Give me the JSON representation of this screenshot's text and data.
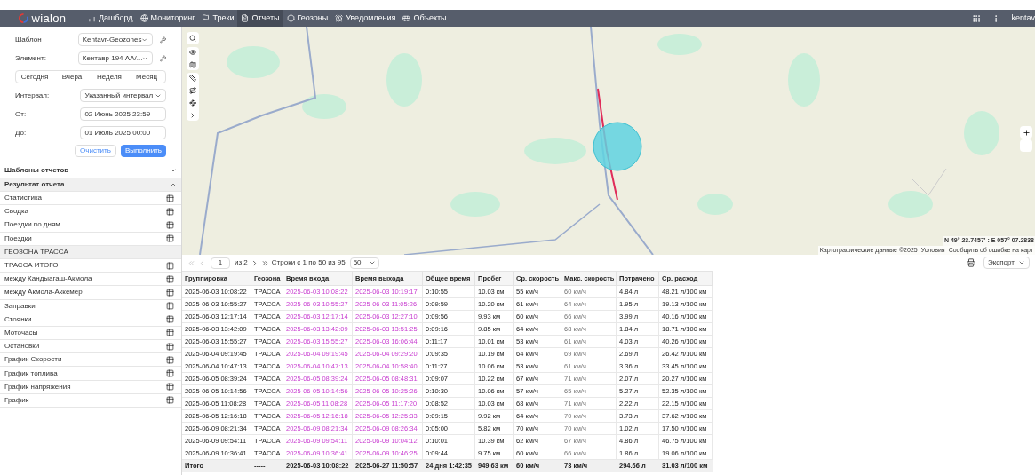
{
  "nav": {
    "logo": "wialon",
    "items": [
      {
        "label": "Дашборд",
        "selected": false
      },
      {
        "label": "Мониторинг",
        "selected": false
      },
      {
        "label": "Треки",
        "selected": false
      },
      {
        "label": "Отчеты",
        "selected": true
      },
      {
        "label": "Геозоны",
        "selected": false
      },
      {
        "label": "Уведомления",
        "selected": false
      },
      {
        "label": "Объекты",
        "selected": false
      }
    ],
    "user": "kentav"
  },
  "form": {
    "template": {
      "label": "Шаблон",
      "value": "Kentavr-Geozones"
    },
    "element": {
      "label": "Элемент:",
      "value": "Кентавр 194 AA/..."
    },
    "periods": [
      {
        "label": "Сегодня",
        "selected": false
      },
      {
        "label": "Вчера",
        "selected": false
      },
      {
        "label": "Неделя",
        "selected": false
      },
      {
        "label": "Месяц",
        "selected": false
      }
    ],
    "interval": {
      "label": "Интервал:",
      "value": "Указанный интервал"
    },
    "from": {
      "label": "От:",
      "value": "02 Июнь 2025 23:59"
    },
    "to": {
      "label": "До:",
      "value": "01 Июль 2025 00:00"
    },
    "buttons": [
      {
        "label": "Очистить",
        "kind": "secondary"
      },
      {
        "label": "Выполнить",
        "kind": "primary"
      }
    ]
  },
  "sections": [
    {
      "title": "Шаблоны отчетов",
      "expanded": false
    },
    {
      "title": "Результат отчета",
      "expanded": true,
      "items": [
        {
          "label": "Статистика",
          "kind": "item"
        },
        {
          "label": "Сводка",
          "kind": "item"
        },
        {
          "label": "Поездки по дням",
          "kind": "item"
        },
        {
          "label": "Поездки",
          "kind": "item"
        },
        {
          "label": "ГЕОЗОНА ТРАССА",
          "kind": "group"
        },
        {
          "label": "ТРАССА ИТОГО",
          "kind": "item"
        },
        {
          "label": "между Кандыагаш-Акмола",
          "kind": "item"
        },
        {
          "label": "между Акмола-Аккемер",
          "kind": "item"
        },
        {
          "label": "Заправки",
          "kind": "item"
        },
        {
          "label": "Стоянки",
          "kind": "item"
        },
        {
          "label": "Моточасы",
          "kind": "item"
        },
        {
          "label": "Остановки",
          "kind": "item"
        },
        {
          "label": "График Скорости",
          "kind": "item"
        },
        {
          "label": "График топлива",
          "kind": "item"
        },
        {
          "label": "График напряжения",
          "kind": "item"
        },
        {
          "label": "График",
          "kind": "item"
        }
      ]
    }
  ],
  "map": {
    "kind": "picture",
    "coords": "N 49° 23.7457' : E 057° 07.2838",
    "attribution": [
      "Картографические данные ©2025",
      "Условия",
      "Сообщить об ошибке на карт"
    ]
  },
  "pager": {
    "page": "1",
    "of": "из 2",
    "range": "Строки с 1 по 50 из 95",
    "page_size": "50",
    "export": "Экспорт"
  },
  "table": {
    "columns": [
      "Группировка",
      "Геозона",
      "Время входа",
      "Время выхода",
      "Общее время",
      "Пробег",
      "Ср. скорость",
      "Макс. скорость",
      "Потрачено",
      "Ср. расход"
    ],
    "rows": [
      [
        "2025-06-03 10:08:22",
        "ТРАССА",
        "2025-06-03 10:08:22",
        "2025-06-03 10:19:17",
        "0:10:55",
        "10.03 км",
        "55 км/ч",
        "60 км/ч",
        "4.84 л",
        "48.21 л/100 км"
      ],
      [
        "2025-06-03 10:55:27",
        "ТРАССА",
        "2025-06-03 10:55:27",
        "2025-06-03 11:05:26",
        "0:09:59",
        "10.20 км",
        "61 км/ч",
        "64 км/ч",
        "1.95 л",
        "19.13 л/100 км"
      ],
      [
        "2025-06-03 12:17:14",
        "ТРАССА",
        "2025-06-03 12:17:14",
        "2025-06-03 12:27:10",
        "0:09:56",
        "9.93 км",
        "60 км/ч",
        "66 км/ч",
        "3.99 л",
        "40.16 л/100 км"
      ],
      [
        "2025-06-03 13:42:09",
        "ТРАССА",
        "2025-06-03 13:42:09",
        "2025-06-03 13:51:25",
        "0:09:16",
        "9.85 км",
        "64 км/ч",
        "68 км/ч",
        "1.84 л",
        "18.71 л/100 км"
      ],
      [
        "2025-06-03 15:55:27",
        "ТРАССА",
        "2025-06-03 15:55:27",
        "2025-06-03 16:06:44",
        "0:11:17",
        "10.01 км",
        "53 км/ч",
        "61 км/ч",
        "4.03 л",
        "40.26 л/100 км"
      ],
      [
        "2025-06-04 09:19:45",
        "ТРАССА",
        "2025-06-04 09:19:45",
        "2025-06-04 09:29:20",
        "0:09:35",
        "10.19 км",
        "64 км/ч",
        "69 км/ч",
        "2.69 л",
        "26.42 л/100 км"
      ],
      [
        "2025-06-04 10:47:13",
        "ТРАССА",
        "2025-06-04 10:47:13",
        "2025-06-04 10:58:40",
        "0:11:27",
        "10.06 км",
        "53 км/ч",
        "61 км/ч",
        "3.36 л",
        "33.45 л/100 км"
      ],
      [
        "2025-06-05 08:39:24",
        "ТРАССА",
        "2025-06-05 08:39:24",
        "2025-06-05 08:48:31",
        "0:09:07",
        "10.22 км",
        "67 км/ч",
        "71 км/ч",
        "2.07 л",
        "20.27 л/100 км"
      ],
      [
        "2025-06-05 10:14:56",
        "ТРАССА",
        "2025-06-05 10:14:56",
        "2025-06-05 10:25:26",
        "0:10:30",
        "10.06 км",
        "57 км/ч",
        "65 км/ч",
        "5.27 л",
        "52.35 л/100 км"
      ],
      [
        "2025-06-05 11:08:28",
        "ТРАССА",
        "2025-06-05 11:08:28",
        "2025-06-05 11:17:20",
        "0:08:52",
        "10.03 км",
        "68 км/ч",
        "71 км/ч",
        "2.22 л",
        "22.15 л/100 км"
      ],
      [
        "2025-06-05 12:16:18",
        "ТРАССА",
        "2025-06-05 12:16:18",
        "2025-06-05 12:25:33",
        "0:09:15",
        "9.92 км",
        "64 км/ч",
        "70 км/ч",
        "3.73 л",
        "37.62 л/100 км"
      ],
      [
        "2025-06-09 08:21:34",
        "ТРАССА",
        "2025-06-09 08:21:34",
        "2025-06-09 08:26:34",
        "0:05:00",
        "5.82 км",
        "70 км/ч",
        "70 км/ч",
        "1.02 л",
        "17.50 л/100 км"
      ],
      [
        "2025-06-09 09:54:11",
        "ТРАССА",
        "2025-06-09 09:54:11",
        "2025-06-09 10:04:12",
        "0:10:01",
        "10.39 км",
        "62 км/ч",
        "67 км/ч",
        "4.86 л",
        "46.75 л/100 км"
      ],
      [
        "2025-06-09 10:36:41",
        "ТРАССА",
        "2025-06-09 10:36:41",
        "2025-06-09 10:46:25",
        "0:09:44",
        "9.75 км",
        "60 км/ч",
        "66 км/ч",
        "1.86 л",
        "19.06 л/100 км"
      ]
    ],
    "total": [
      "Итого",
      "-----",
      "2025-06-03 10:08:22",
      "2025-06-27 11:50:57",
      "24 дня 1:42:35",
      "949.63 км",
      "60 км/ч",
      "73 км/ч",
      "294.66 л",
      "31.03 л/100 км"
    ]
  }
}
